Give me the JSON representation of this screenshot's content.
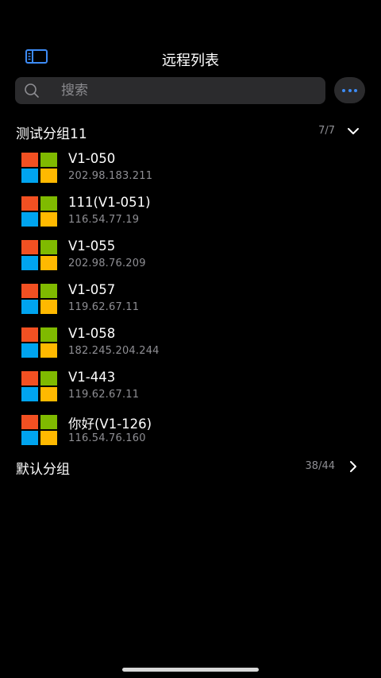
{
  "header": {
    "title": "远程列表",
    "sidebar_icon": "sidebar-toggle-icon"
  },
  "search": {
    "placeholder": "搜索",
    "value": "",
    "icon": "search-icon"
  },
  "more_button": {
    "icon": "more-horizontal-icon",
    "accent_color": "#3d8bf5"
  },
  "groups": [
    {
      "name": "测试分组11",
      "count": "7/7",
      "expanded": true,
      "chevron_icon": "chevron-down-icon",
      "items": [
        {
          "name": "V1-050",
          "ip": "202.98.183.211",
          "icon": "windows-icon"
        },
        {
          "name": "111(V1-051)",
          "ip": "116.54.77.19",
          "icon": "windows-icon"
        },
        {
          "name": "V1-055",
          "ip": "202.98.76.209",
          "icon": "windows-icon"
        },
        {
          "name": "V1-057",
          "ip": "119.62.67.11",
          "icon": "windows-icon"
        },
        {
          "name": "V1-058",
          "ip": "182.245.204.244",
          "icon": "windows-icon"
        },
        {
          "name": "V1-443",
          "ip": "119.62.67.11",
          "icon": "windows-icon"
        },
        {
          "name": "你好(V1-126)",
          "ip": "116.54.76.160",
          "icon": "windows-icon"
        }
      ]
    },
    {
      "name": "默认分组",
      "count": "38/44",
      "expanded": false,
      "chevron_icon": "chevron-right-icon"
    }
  ],
  "colors": {
    "background": "#000000",
    "surface": "#2b2b2d",
    "secondary_text": "#8e8e93",
    "windows_red": "#f25022",
    "windows_green": "#7fba00",
    "windows_blue": "#00a4ef",
    "windows_yellow": "#ffb900"
  }
}
